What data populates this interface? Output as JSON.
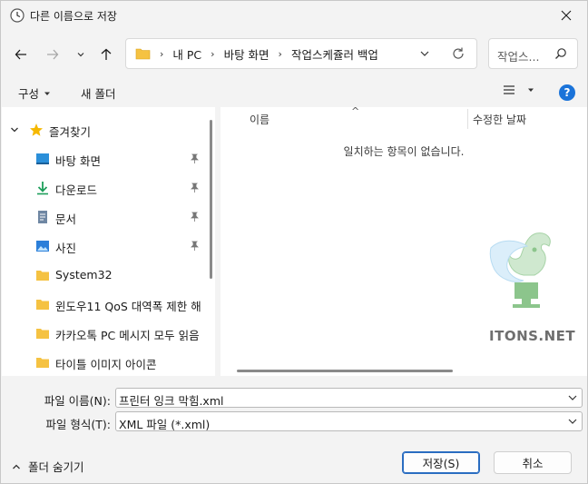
{
  "window": {
    "title": "다른 이름으로 저장"
  },
  "address_bar": {
    "breadcrumbs": [
      "내 PC",
      "바탕 화면",
      "작업스케쥴러 백업"
    ]
  },
  "search": {
    "placeholder": "작업스..."
  },
  "toolbar": {
    "organize_label": "구성",
    "new_folder_label": "새 폴더"
  },
  "nav_pane": {
    "quick_access_label": "즐겨찾기",
    "items": [
      {
        "label": "바탕 화면",
        "icon": "desktop-icon",
        "pinned": true
      },
      {
        "label": "다운로드",
        "icon": "download-icon",
        "pinned": true
      },
      {
        "label": "문서",
        "icon": "document-icon",
        "pinned": true
      },
      {
        "label": "사진",
        "icon": "pictures-icon",
        "pinned": true
      },
      {
        "label": "System32",
        "icon": "folder-icon",
        "pinned": false
      },
      {
        "label": "윈도우11 QoS 대역폭 제한 해",
        "icon": "folder-icon",
        "pinned": false
      },
      {
        "label": "카카오톡 PC 메시지 모두 읽음",
        "icon": "folder-icon",
        "pinned": false
      },
      {
        "label": "타이틀 이미지 아이콘",
        "icon": "folder-icon",
        "pinned": false
      }
    ]
  },
  "file_list": {
    "columns": [
      "이름",
      "수정한 날짜"
    ],
    "empty_message": "일치하는 항목이 없습니다."
  },
  "watermark": {
    "text": "ITONS.NET"
  },
  "save_form": {
    "filename_label": "파일 이름(N):",
    "filename_value": "프린터 잉크 막힘.xml",
    "filetype_label": "파일 형식(T):",
    "filetype_value": "XML 파일 (*.xml)"
  },
  "footer": {
    "hide_folders_label": "폴더 숨기기",
    "save_label": "저장(S)",
    "cancel_label": "취소"
  },
  "colors": {
    "accent": "#1a73d9",
    "folder": "#f5c242",
    "primary_border": "#2a6dc1"
  }
}
